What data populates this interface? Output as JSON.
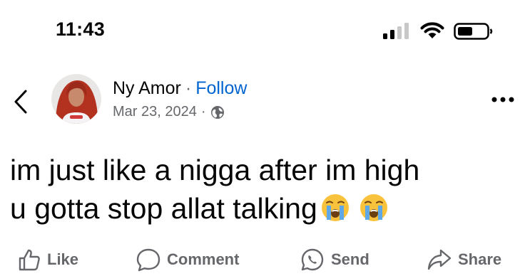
{
  "status_bar": {
    "time": "11:43",
    "icons": [
      "cellular-signal-icon",
      "wifi-icon",
      "battery-icon"
    ]
  },
  "header": {
    "back_icon": "chevron-left-icon",
    "author_name": "Ny Amor",
    "separator": "·",
    "follow_label": "Follow",
    "date": "Mar 23, 2024",
    "audience_icon": "globe-icon",
    "more_icon": "more-dots-icon"
  },
  "post": {
    "line1": "im just like a nigga after im high",
    "line2": "u gotta stop allat talking",
    "emojis": [
      "loudly-crying-face",
      "loudly-crying-face"
    ]
  },
  "actions": {
    "like_label": "Like",
    "comment_label": "Comment",
    "send_label": "Send",
    "share_label": "Share"
  },
  "colors": {
    "text": "#050505",
    "secondary": "#65676b",
    "link": "#0064d1",
    "emoji_face": "#f9c23c",
    "emoji_tears": "#5ea8e8"
  }
}
